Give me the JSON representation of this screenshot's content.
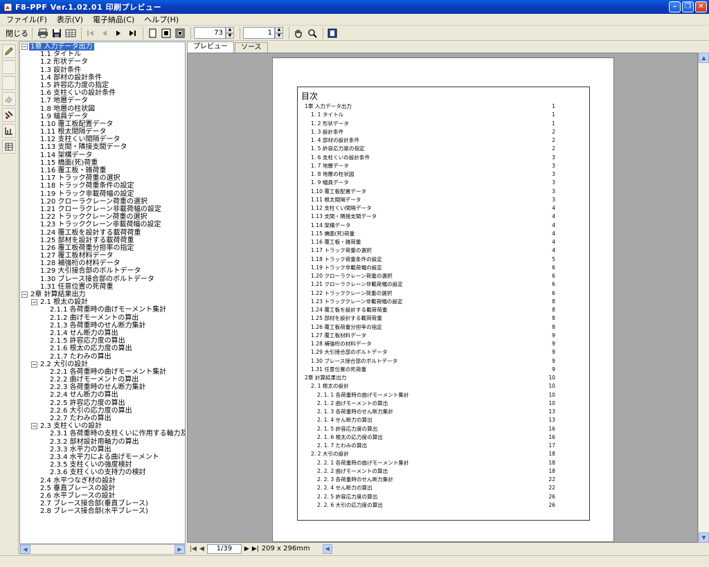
{
  "window": {
    "title": "F8-PPF Ver.1.02.01 印刷プレビュー"
  },
  "menu": [
    "ファイル(F)",
    "表示(V)",
    "電子納品(C)",
    "ヘルプ(H)"
  ],
  "toolbar": {
    "close_label": "閉じる",
    "zoom_value": "73",
    "page_value": "1"
  },
  "tabs": [
    "プレビュー",
    "ソース"
  ],
  "tree": [
    {
      "label": "1章 入力データ出力",
      "level": 0,
      "exp": "−",
      "selected": true
    },
    {
      "label": "1.1 タイトル",
      "level": 1
    },
    {
      "label": "1.2 形状データ",
      "level": 1
    },
    {
      "label": "1.3 設計条件",
      "level": 1
    },
    {
      "label": "1.4 部材の設計条件",
      "level": 1
    },
    {
      "label": "1.5 許容応力度の指定",
      "level": 1
    },
    {
      "label": "1.6 支柱くいの設計条件",
      "level": 1
    },
    {
      "label": "1.7 地層データ",
      "level": 1
    },
    {
      "label": "1.8 地層の柱状図",
      "level": 1
    },
    {
      "label": "1.9 幅員データ",
      "level": 1
    },
    {
      "label": "1.10 覆工板配置データ",
      "level": 1
    },
    {
      "label": "1.11 根太間隔データ",
      "level": 1
    },
    {
      "label": "1.12 支柱くい間隔データ",
      "level": 1
    },
    {
      "label": "1.13 支間・隣接支間データ",
      "level": 1
    },
    {
      "label": "1.14 架構データ",
      "level": 1
    },
    {
      "label": "1.15 橋面(死)荷重",
      "level": 1
    },
    {
      "label": "1.16 覆工板・雑荷重",
      "level": 1
    },
    {
      "label": "1.17 トラック荷重の選択",
      "level": 1
    },
    {
      "label": "1.18 トラック荷重条件の設定",
      "level": 1
    },
    {
      "label": "1.19 トラック非載荷幅の設定",
      "level": 1
    },
    {
      "label": "1.20 クローラクレーン荷重の選択",
      "level": 1
    },
    {
      "label": "1.21 クローラクレーン非載荷幅の設定",
      "level": 1
    },
    {
      "label": "1.22 トラッククレーン荷重の選択",
      "level": 1
    },
    {
      "label": "1.23 トラッククレーン非載荷幅の設定",
      "level": 1
    },
    {
      "label": "1.24 覆工板を設計する載荷荷重",
      "level": 1
    },
    {
      "label": "1.25 部材を設計する載荷荷重",
      "level": 1
    },
    {
      "label": "1.26 覆工板荷重分担率の指定",
      "level": 1
    },
    {
      "label": "1.27 覆工板材料データ",
      "level": 1
    },
    {
      "label": "1.28 補強桁の材料データ",
      "level": 1
    },
    {
      "label": "1.29 大引接合部のボルトデータ",
      "level": 1
    },
    {
      "label": "1.30 ブレース接合部のボルトデータ",
      "level": 1
    },
    {
      "label": "1.31 任意位置の死荷重",
      "level": 1
    },
    {
      "label": "2章 計算結果出力",
      "level": 0,
      "exp": "−"
    },
    {
      "label": "2.1 根太の設計",
      "level": 1,
      "exp": "−"
    },
    {
      "label": "2.1.1 各荷重時の曲げモーメント集計",
      "level": 2
    },
    {
      "label": "2.1.2 曲げモーメントの算出",
      "level": 2
    },
    {
      "label": "2.1.3 各荷重時のせん断力集計",
      "level": 2
    },
    {
      "label": "2.1.4 せん断力の算出",
      "level": 2
    },
    {
      "label": "2.1.5 許容応力度の算出",
      "level": 2
    },
    {
      "label": "2.1.6 根太の応力度の算出",
      "level": 2
    },
    {
      "label": "2.1.7 たわみの算出",
      "level": 2
    },
    {
      "label": "2.2 大引の設計",
      "level": 1,
      "exp": "−"
    },
    {
      "label": "2.2.1 各荷重時の曲げモーメント集計",
      "level": 2
    },
    {
      "label": "2.2.2 曲げモーメントの算出",
      "level": 2
    },
    {
      "label": "2.2.3 各荷重時のせん断力集計",
      "level": 2
    },
    {
      "label": "2.2.4 せん断力の算出",
      "level": 2
    },
    {
      "label": "2.2.5 許容応力度の算出",
      "level": 2
    },
    {
      "label": "2.2.6 大引の応力度の算出",
      "level": 2
    },
    {
      "label": "2.2.7 たわみの算出",
      "level": 2
    },
    {
      "label": "2.3 支柱くいの設計",
      "level": 1,
      "exp": "−"
    },
    {
      "label": "2.3.1 各荷重時の支柱くいに作用する軸力及び",
      "level": 2
    },
    {
      "label": "2.3.2 部材設計用軸力の算出",
      "level": 2
    },
    {
      "label": "2.3.3 水平力の算出",
      "level": 2
    },
    {
      "label": "2.3.4 水平力による曲げモーメント",
      "level": 2
    },
    {
      "label": "2.3.5 支柱くいの強度検討",
      "level": 2
    },
    {
      "label": "2.3.6 支柱くいの支持力の検討",
      "level": 2
    },
    {
      "label": "2.4 水平つなぎ材の設計",
      "level": 1
    },
    {
      "label": "2.5 垂直ブレースの設計",
      "level": 1
    },
    {
      "label": "2.6 水平ブレースの設計",
      "level": 1
    },
    {
      "label": "2.7 ブレース接合部(垂直ブレース)",
      "level": 1
    },
    {
      "label": "2.8 ブレース接合部(水平ブレース)",
      "level": 1
    }
  ],
  "toc": {
    "title": "目次",
    "rows": [
      {
        "label": "1章 入力データ出力",
        "page": "1",
        "indent": 0
      },
      {
        "label": "1. 1 タイトル",
        "page": "1",
        "indent": 1
      },
      {
        "label": "1. 2 形状データ",
        "page": "1",
        "indent": 1
      },
      {
        "label": "1. 3 設計条件",
        "page": "2",
        "indent": 1
      },
      {
        "label": "1. 4 部材の設計条件",
        "page": "2",
        "indent": 1
      },
      {
        "label": "1. 5 許容応力度の指定",
        "page": "2",
        "indent": 1
      },
      {
        "label": "1. 6 支柱くいの設計条件",
        "page": "3",
        "indent": 1
      },
      {
        "label": "1. 7 地層データ",
        "page": "3",
        "indent": 1
      },
      {
        "label": "1. 8 地層の柱状図",
        "page": "3",
        "indent": 1
      },
      {
        "label": "1. 9 幅員データ",
        "page": "3",
        "indent": 1
      },
      {
        "label": "1.10 覆工板配置データ",
        "page": "3",
        "indent": 1
      },
      {
        "label": "1.11 根太間隔データ",
        "page": "3",
        "indent": 1
      },
      {
        "label": "1.12 支柱くい間隔データ",
        "page": "4",
        "indent": 1
      },
      {
        "label": "1.13 支間・隣接支間データ",
        "page": "4",
        "indent": 1
      },
      {
        "label": "1.14 架構データ",
        "page": "4",
        "indent": 1
      },
      {
        "label": "1.15 橋面(死)荷重",
        "page": "4",
        "indent": 1
      },
      {
        "label": "1.16 覆工板・雑荷重",
        "page": "4",
        "indent": 1
      },
      {
        "label": "1.17 トラック荷重の選択",
        "page": "4",
        "indent": 1
      },
      {
        "label": "1.18 トラック荷重条件の設定",
        "page": "5",
        "indent": 1
      },
      {
        "label": "1.19 トラック非載荷幅の設定",
        "page": "6",
        "indent": 1
      },
      {
        "label": "1.20 クローラクレーン荷重の選択",
        "page": "6",
        "indent": 1
      },
      {
        "label": "1.21 クローラクレーン非載荷幅の設定",
        "page": "6",
        "indent": 1
      },
      {
        "label": "1.22 トラッククレーン荷重の選択",
        "page": "6",
        "indent": 1
      },
      {
        "label": "1.23 トラッククレーン非載荷幅の設定",
        "page": "8",
        "indent": 1
      },
      {
        "label": "1.24 覆工板を設計する載荷荷重",
        "page": "8",
        "indent": 1
      },
      {
        "label": "1.25 部材を設計する載荷荷重",
        "page": "8",
        "indent": 1
      },
      {
        "label": "1.26 覆工板荷重分担率の指定",
        "page": "8",
        "indent": 1
      },
      {
        "label": "1.27 覆工板材料データ",
        "page": "9",
        "indent": 1
      },
      {
        "label": "1.28 補強桁の材料データ",
        "page": "9",
        "indent": 1
      },
      {
        "label": "1.29 大引接合部のボルトデータ",
        "page": "9",
        "indent": 1
      },
      {
        "label": "1.30 ブレース接合部のボルトデータ",
        "page": "9",
        "indent": 1
      },
      {
        "label": "1.31 任意位置の死荷重",
        "page": "9",
        "indent": 1
      },
      {
        "label": "2章 計算結果出力",
        "page": "10",
        "indent": 0
      },
      {
        "label": "2. 1 根太の設計",
        "page": "10",
        "indent": 1
      },
      {
        "label": "2. 1. 1 各荷重時の曲げモーメント集計",
        "page": "10",
        "indent": 2
      },
      {
        "label": "2. 1. 2 曲げモーメントの算出",
        "page": "10",
        "indent": 2
      },
      {
        "label": "2. 1. 3 各荷重時のせん断力集計",
        "page": "13",
        "indent": 2
      },
      {
        "label": "2. 1. 4 せん断力の算出",
        "page": "13",
        "indent": 2
      },
      {
        "label": "2. 1. 5 許容応力度の算出",
        "page": "16",
        "indent": 2
      },
      {
        "label": "2. 1. 6 根太の応力度の算出",
        "page": "16",
        "indent": 2
      },
      {
        "label": "2. 1. 7 たわみの算出",
        "page": "17",
        "indent": 2
      },
      {
        "label": "2. 2 大引の設計",
        "page": "18",
        "indent": 1
      },
      {
        "label": "2. 2. 1 各荷重時の曲げモーメント集計",
        "page": "18",
        "indent": 2
      },
      {
        "label": "2. 2. 2 曲げモーメントの算出",
        "page": "18",
        "indent": 2
      },
      {
        "label": "2. 2. 3 各荷重時のせん断力集計",
        "page": "22",
        "indent": 2
      },
      {
        "label": "2. 2. 4 せん断力の算出",
        "page": "22",
        "indent": 2
      },
      {
        "label": "2. 2. 5 許容応力度の算出",
        "page": "26",
        "indent": 2
      },
      {
        "label": "2. 2. 6 大引の応力度の算出",
        "page": "26",
        "indent": 2
      }
    ]
  },
  "bottom": {
    "page_indicator": "1/39",
    "paper_size": "209 x 296mm"
  },
  "colors": {
    "title_bar": "#0a3fc0",
    "selection": "#316ac5",
    "preview_bg": "#a8a8a8"
  }
}
